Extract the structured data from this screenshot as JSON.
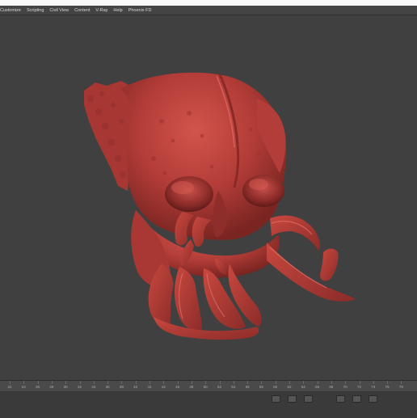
{
  "menubar": {
    "items": [
      "Customize",
      "Scripting",
      "Civil View",
      "Content",
      "V-Ray",
      "Help",
      "Phoenix FD"
    ]
  },
  "viewport": {
    "model_color": "#b8403c",
    "background_color": "#404040"
  },
  "timeline": {
    "ticks": [
      "22",
      "24",
      "26",
      "28",
      "30",
      "32",
      "34",
      "36",
      "38",
      "40",
      "42",
      "44",
      "46",
      "48",
      "50",
      "52",
      "54",
      "56",
      "58",
      "60",
      "62",
      "64",
      "66",
      "68",
      "70",
      "72",
      "74",
      "76",
      "78"
    ]
  }
}
